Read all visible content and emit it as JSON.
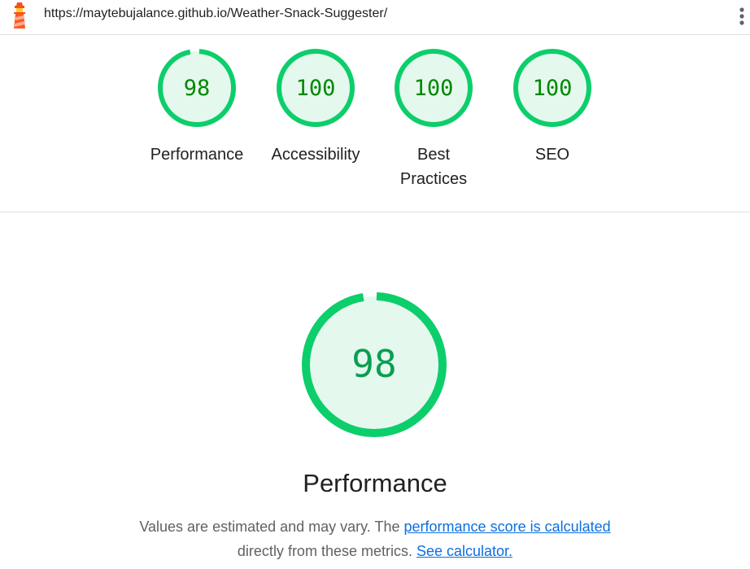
{
  "header": {
    "url": "https://maytebujalance.github.io/Weather-Snack-Suggester/",
    "logo_icon": "lighthouse-icon",
    "menu_icon": "more-vert-icon"
  },
  "colors": {
    "pass_stroke": "#0cce6b",
    "pass_fill": "#e5f8ee",
    "pass_text": "#008800"
  },
  "gauges": [
    {
      "score": "98",
      "label": "Performance",
      "value": 0.98
    },
    {
      "score": "100",
      "label": "Accessibility",
      "value": 1.0
    },
    {
      "score": "100",
      "label_line1": "Best",
      "label_line2": "Practices",
      "value": 1.0
    },
    {
      "score": "100",
      "label": "SEO",
      "value": 1.0
    }
  ],
  "main": {
    "score": "98",
    "value": 0.98,
    "title": "Performance",
    "desc_text1": "Values are estimated and may vary. The ",
    "desc_link1": "performance score is calculated",
    "desc_text2": "directly from these metrics. ",
    "desc_link2": "See calculator."
  }
}
